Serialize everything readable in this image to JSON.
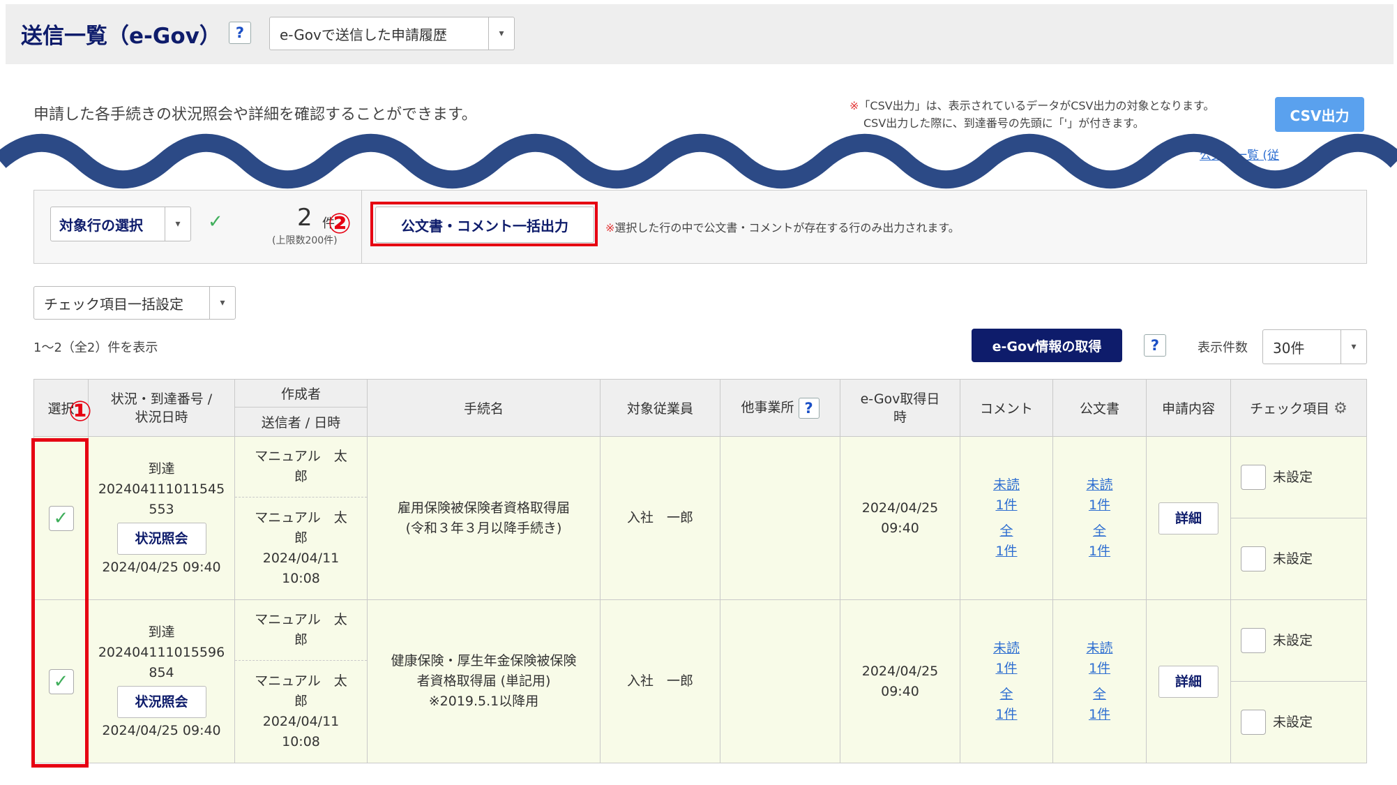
{
  "header": {
    "title": "送信一覧（e-Gov）",
    "help_label": "?",
    "history_select": "e-Govで送信した申請履歴",
    "dropdown_arrow": "▾"
  },
  "description": "申請した各手続きの状況照会や詳細を確認することができます。",
  "csv": {
    "note_mark": "※",
    "note_line1": "「CSV出力」は、表示されているデータがCSV出力の対象となります。",
    "note_line2": "CSV出力した際に、到達番号の先頭に「'」が付きます。",
    "button": "CSV出力",
    "partial_link": "公文書一覧 (従"
  },
  "action_bar": {
    "target_select": "対象行の選択",
    "checkmark": "✓",
    "count": "2",
    "count_unit": "件",
    "limit_note": "(上限数200件)",
    "bulk_button": "公文書・コメント一括出力",
    "bulk_note_mark": "※",
    "bulk_note": "選択した行の中で公文書・コメントが存在する行のみ出力されます。",
    "marker_1": "①",
    "marker_2": "②"
  },
  "controls": {
    "check_bulk_select": "チェック項目一括設定",
    "range_text": "1〜2（全2）件を表示",
    "egov_fetch_button": "e-Gov情報の取得",
    "help_label": "?",
    "per_page_label": "表示件数",
    "per_page_value": "30件"
  },
  "table": {
    "headers": {
      "select": "選択",
      "status": "状況・到達番号 /\n状況日時",
      "creator": "作成者",
      "sender": "送信者 / 日時",
      "procedure": "手続名",
      "employee": "対象従業員",
      "other_office": "他事業所",
      "egov_date": "e-Gov取得日\n時",
      "comment": "コメント",
      "official_doc": "公文書",
      "application": "申請内容",
      "check_items": "チェック項目"
    },
    "rows": [
      {
        "status": "到達",
        "arrival_no_1": "202404111011545",
        "arrival_no_2": "553",
        "status_button": "状況照会",
        "status_datetime": "2024/04/25 09:40",
        "creator_1": "マニュアル　太",
        "creator_2": "郎",
        "sender_1": "マニュアル　太",
        "sender_2": "郎",
        "sender_date": "2024/04/11",
        "sender_time": "10:08",
        "procedure_1": "雇用保険被保険者資格取得届",
        "procedure_2": "(令和３年３月以降手続き)",
        "procedure_3": "",
        "employee": "入社　一郎",
        "egov_date": "2024/04/25",
        "egov_time": "09:40",
        "comment_unread": "未読",
        "comment_unread_count": "1件",
        "comment_all": "全",
        "comment_all_count": "1件",
        "doc_unread": "未読",
        "doc_unread_count": "1件",
        "doc_all": "全",
        "doc_all_count": "1件",
        "detail_button": "詳細",
        "check_1": "未設定",
        "check_2": "未設定"
      },
      {
        "status": "到達",
        "arrival_no_1": "202404111015596",
        "arrival_no_2": "854",
        "status_button": "状況照会",
        "status_datetime": "2024/04/25 09:40",
        "creator_1": "マニュアル　太",
        "creator_2": "郎",
        "sender_1": "マニュアル　太",
        "sender_2": "郎",
        "sender_date": "2024/04/11",
        "sender_time": "10:08",
        "procedure_1": "健康保険・厚生年金保険被保険",
        "procedure_2": "者資格取得届 (単記用)",
        "procedure_3": "※2019.5.1以降用",
        "employee": "入社　一郎",
        "egov_date": "2024/04/25",
        "egov_time": "09:40",
        "comment_unread": "未読",
        "comment_unread_count": "1件",
        "comment_all": "全",
        "comment_all_count": "1件",
        "doc_unread": "未読",
        "doc_unread_count": "1件",
        "doc_all": "全",
        "doc_all_count": "1件",
        "detail_button": "詳細",
        "check_1": "未設定",
        "check_2": "未設定"
      }
    ]
  },
  "colors": {
    "navy": "#0e1c6b",
    "accent_blue": "#5aa1ee",
    "highlight_red": "#e60012",
    "wave": "#2c4a86",
    "row_bg": "#f8fbe8"
  }
}
